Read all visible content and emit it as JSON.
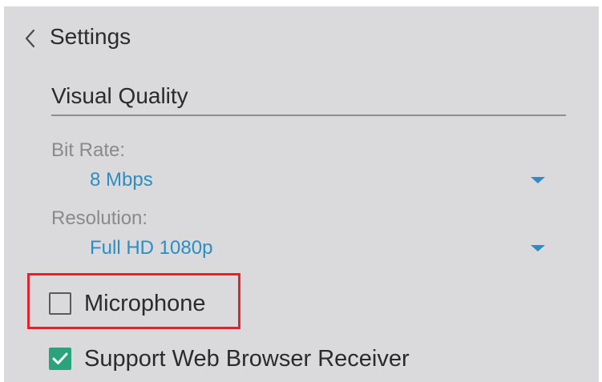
{
  "header": {
    "back_icon": "chevron-left-icon",
    "title": "Settings"
  },
  "visual_quality": {
    "section_title": "Visual Quality",
    "bit_rate": {
      "label": "Bit Rate:",
      "value": "8 Mbps"
    },
    "resolution": {
      "label": "Resolution:",
      "value": "Full HD 1080p"
    }
  },
  "options": {
    "microphone": {
      "label": "Microphone",
      "checked": false
    },
    "web_browser_receiver": {
      "label": "Support Web Browser Receiver",
      "checked": true
    }
  },
  "colors": {
    "background": "#dadadc",
    "accent_blue": "#2b8ec3",
    "checkbox_green": "#2aa37d",
    "highlight_red": "#e2222d"
  }
}
